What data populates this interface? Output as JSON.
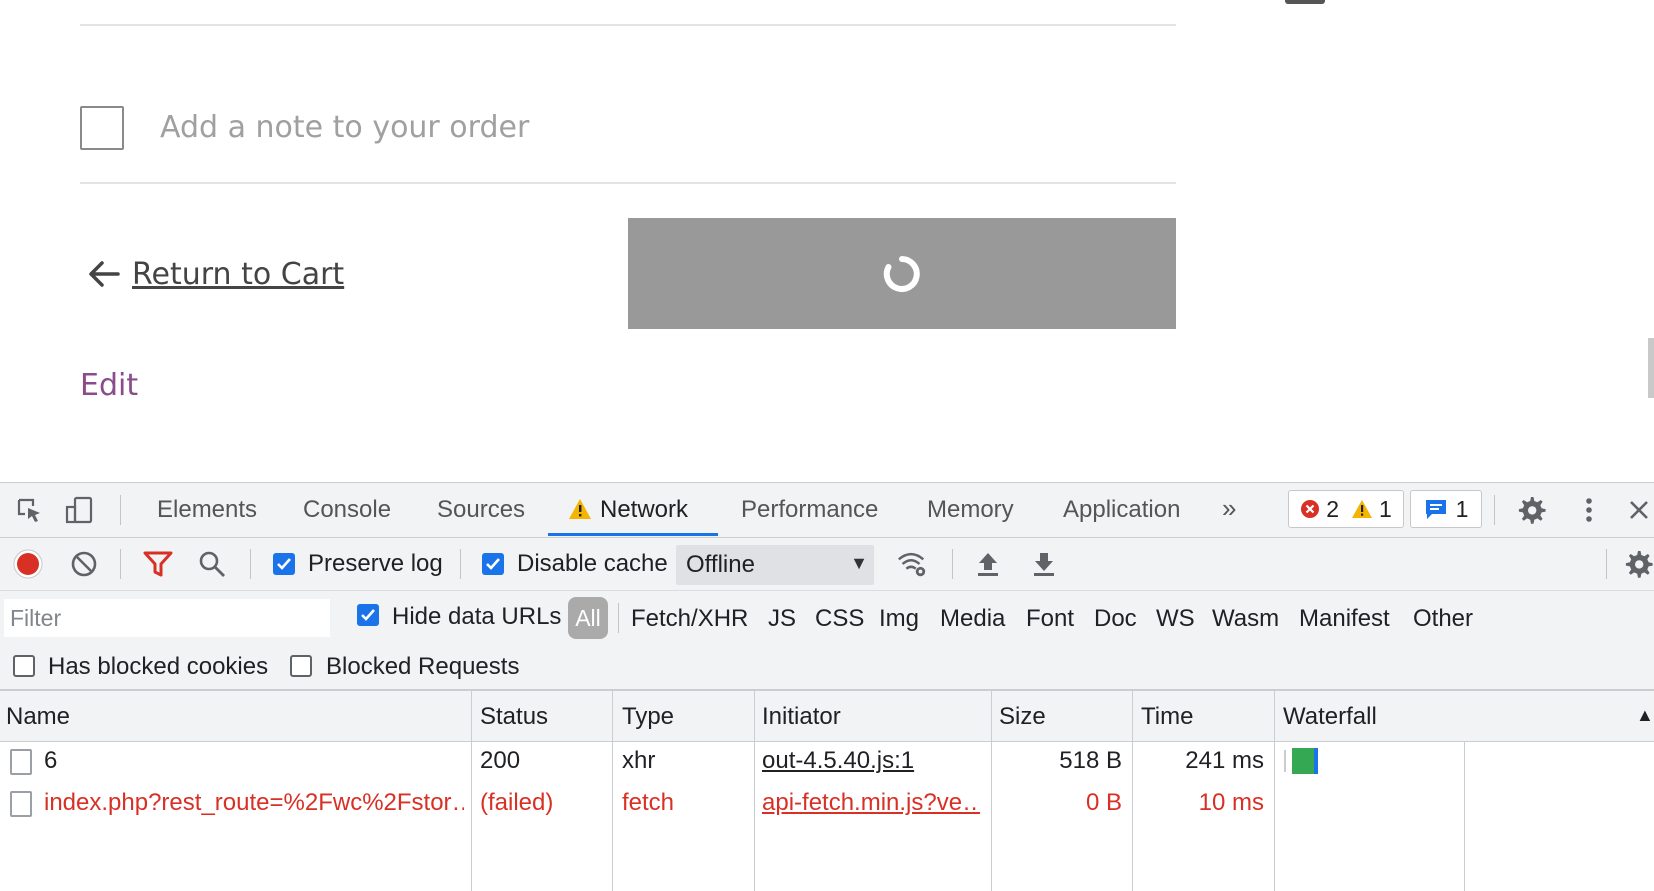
{
  "page": {
    "note_label": "Add a note to your order",
    "return_label": "Return to Cart",
    "edit_label": "Edit"
  },
  "devtools": {
    "tabs": [
      "Elements",
      "Console",
      "Sources",
      "Network",
      "Performance",
      "Memory",
      "Application"
    ],
    "more_tabs_glyph": "»",
    "errors_count": "2",
    "warnings_count": "1",
    "messages_count": "1",
    "toolbar": {
      "preserve_log": "Preserve log",
      "preserve_log_checked": true,
      "disable_cache": "Disable cache",
      "disable_cache_checked": true,
      "throttle_value": "Offline"
    },
    "filter": {
      "placeholder": "Filter",
      "hide_data_urls": "Hide data URLs",
      "hide_data_urls_checked": true,
      "types": [
        "All",
        "Fetch/XHR",
        "JS",
        "CSS",
        "Img",
        "Media",
        "Font",
        "Doc",
        "WS",
        "Wasm",
        "Manifest",
        "Other"
      ],
      "active_type": "All",
      "has_blocked_cookies": "Has blocked cookies",
      "blocked_requests": "Blocked Requests"
    },
    "table": {
      "columns": [
        "Name",
        "Status",
        "Type",
        "Initiator",
        "Size",
        "Time",
        "Waterfall"
      ],
      "rows": [
        {
          "name": "6",
          "status": "200",
          "type": "xhr",
          "initiator": "out-4.5.40.js:1",
          "size": "518 B",
          "time": "241 ms",
          "failed": false
        },
        {
          "name": "index.php?rest_route=%2Fwc%2Fstor…",
          "status": "(failed)",
          "type": "fetch",
          "initiator": "api-fetch.min.js?ve…",
          "size": "0 B",
          "time": "10 ms",
          "failed": true
        }
      ]
    },
    "colors": {
      "accent": "#1a73e8",
      "error": "#d93025",
      "record": "#d93025",
      "waterfall_bar": "#34a853"
    }
  }
}
